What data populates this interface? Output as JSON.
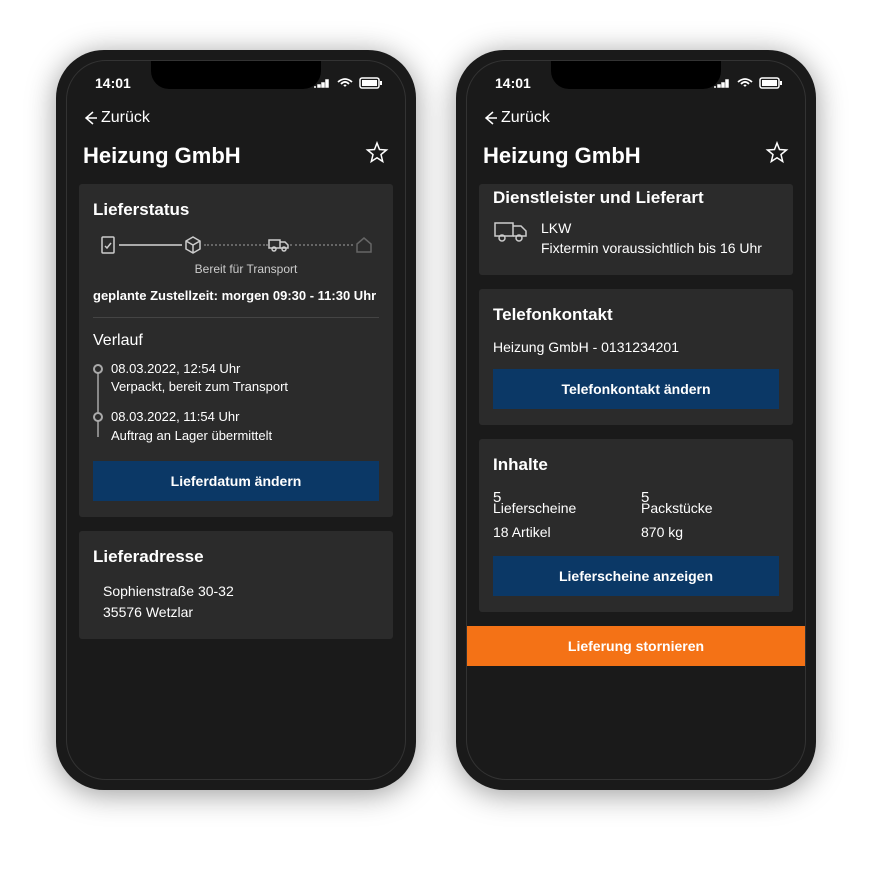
{
  "statusbar": {
    "time": "14:01"
  },
  "nav": {
    "back_label": "Zurück"
  },
  "title": "Heizung GmbH",
  "left": {
    "status_heading": "Lieferstatus",
    "status_caption": "Bereit für Transport",
    "planned_prefix": "geplante Zustellzeit: ",
    "planned_value": "morgen 09:30 - 11:30 Uhr",
    "history_heading": "Verlauf",
    "history": [
      {
        "time": "08.03.2022, 12:54 Uhr",
        "text": "Verpackt, bereit zum Transport"
      },
      {
        "time": "08.03.2022, 11:54 Uhr",
        "text": "Auftrag an Lager übermittelt"
      }
    ],
    "change_date_btn": "Lieferdatum ändern",
    "address_heading": "Lieferadresse",
    "address_line1": "Sophienstraße 30-32",
    "address_line2": "35576 Wetzlar"
  },
  "right": {
    "provider_heading": "Dienstleister und Lieferart",
    "provider_line1": "LKW",
    "provider_line2": "Fixtermin voraussichtlich bis 16 Uhr",
    "contact_heading": "Telefonkontakt",
    "contact_value": "Heizung GmbH - 0131234201",
    "change_contact_btn": "Telefonkontakt ändern",
    "contents_heading": "Inhalte",
    "contents": {
      "lieferscheine_num": "5",
      "lieferscheine_lbl": "Lieferscheine",
      "packstuecke_num": "5",
      "packstuecke_lbl": "Packstücke",
      "artikel": "18 Artikel",
      "gewicht": "870 kg"
    },
    "show_slips_btn": "Lieferscheine anzeigen",
    "cancel_btn": "Lieferung stornieren"
  }
}
